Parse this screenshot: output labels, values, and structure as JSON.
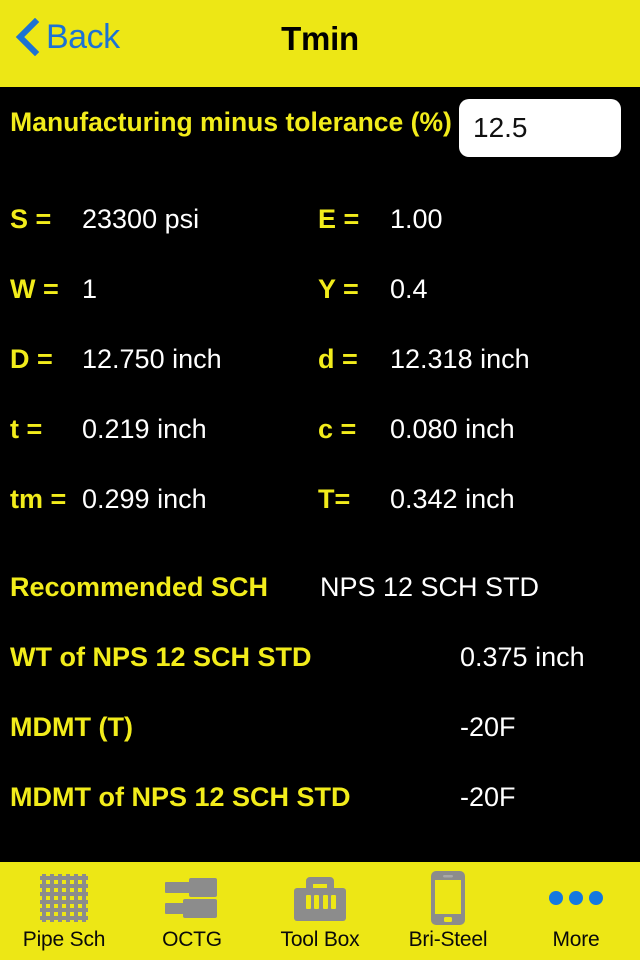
{
  "navbar": {
    "back_label": "Back",
    "back_icon": "chevron-left-icon",
    "title": "Tmin",
    "bg_color": "#EDE715",
    "back_color": "#1C72D4",
    "title_color": "#000000"
  },
  "tolerance": {
    "label": "Manufacturing minus tolerance (%)",
    "value": "12.5",
    "placeholder": "12.5",
    "label_color": "#F2EC1B"
  },
  "params": [
    {
      "left": {
        "label": "S =",
        "value": "23300 psi"
      },
      "right": {
        "label": "E =",
        "value": "1.00"
      }
    },
    {
      "left": {
        "label": "W =",
        "value": "1"
      },
      "right": {
        "label": "Y =",
        "value": "0.4"
      }
    },
    {
      "left": {
        "label": "D =",
        "value": "12.750 inch"
      },
      "right": {
        "label": "d =",
        "value": "12.318 inch"
      }
    },
    {
      "left": {
        "label": "t =",
        "value": "0.219 inch"
      },
      "right": {
        "label": "c =",
        "value": "0.080 inch"
      }
    },
    {
      "left": {
        "label": "tm =",
        "value": "0.299 inch"
      },
      "right": {
        "label": "T=",
        "value": "0.342 inch"
      }
    }
  ],
  "results": [
    {
      "label": "Recommended SCH",
      "value": "NPS 12 SCH STD"
    },
    {
      "label": "WT of NPS 12 SCH STD",
      "value": "0.375 inch"
    },
    {
      "label": "MDMT (T)",
      "value": "-20F"
    },
    {
      "label": "MDMT of NPS 12 SCH STD",
      "value": "-20F"
    }
  ],
  "tabbar": {
    "bg_color": "#EDE715",
    "icon_color": "#8C8C8C",
    "more_dot_color": "#1478E0",
    "items": [
      {
        "label": "Pipe Sch",
        "icon": "grid-mesh-icon"
      },
      {
        "label": "OCTG",
        "icon": "pipe-coupling-icon"
      },
      {
        "label": "Tool Box",
        "icon": "toolbox-icon"
      },
      {
        "label": "Bri-Steel",
        "icon": "smartphone-icon"
      },
      {
        "label": "More",
        "icon": "more-dots-icon"
      }
    ]
  }
}
